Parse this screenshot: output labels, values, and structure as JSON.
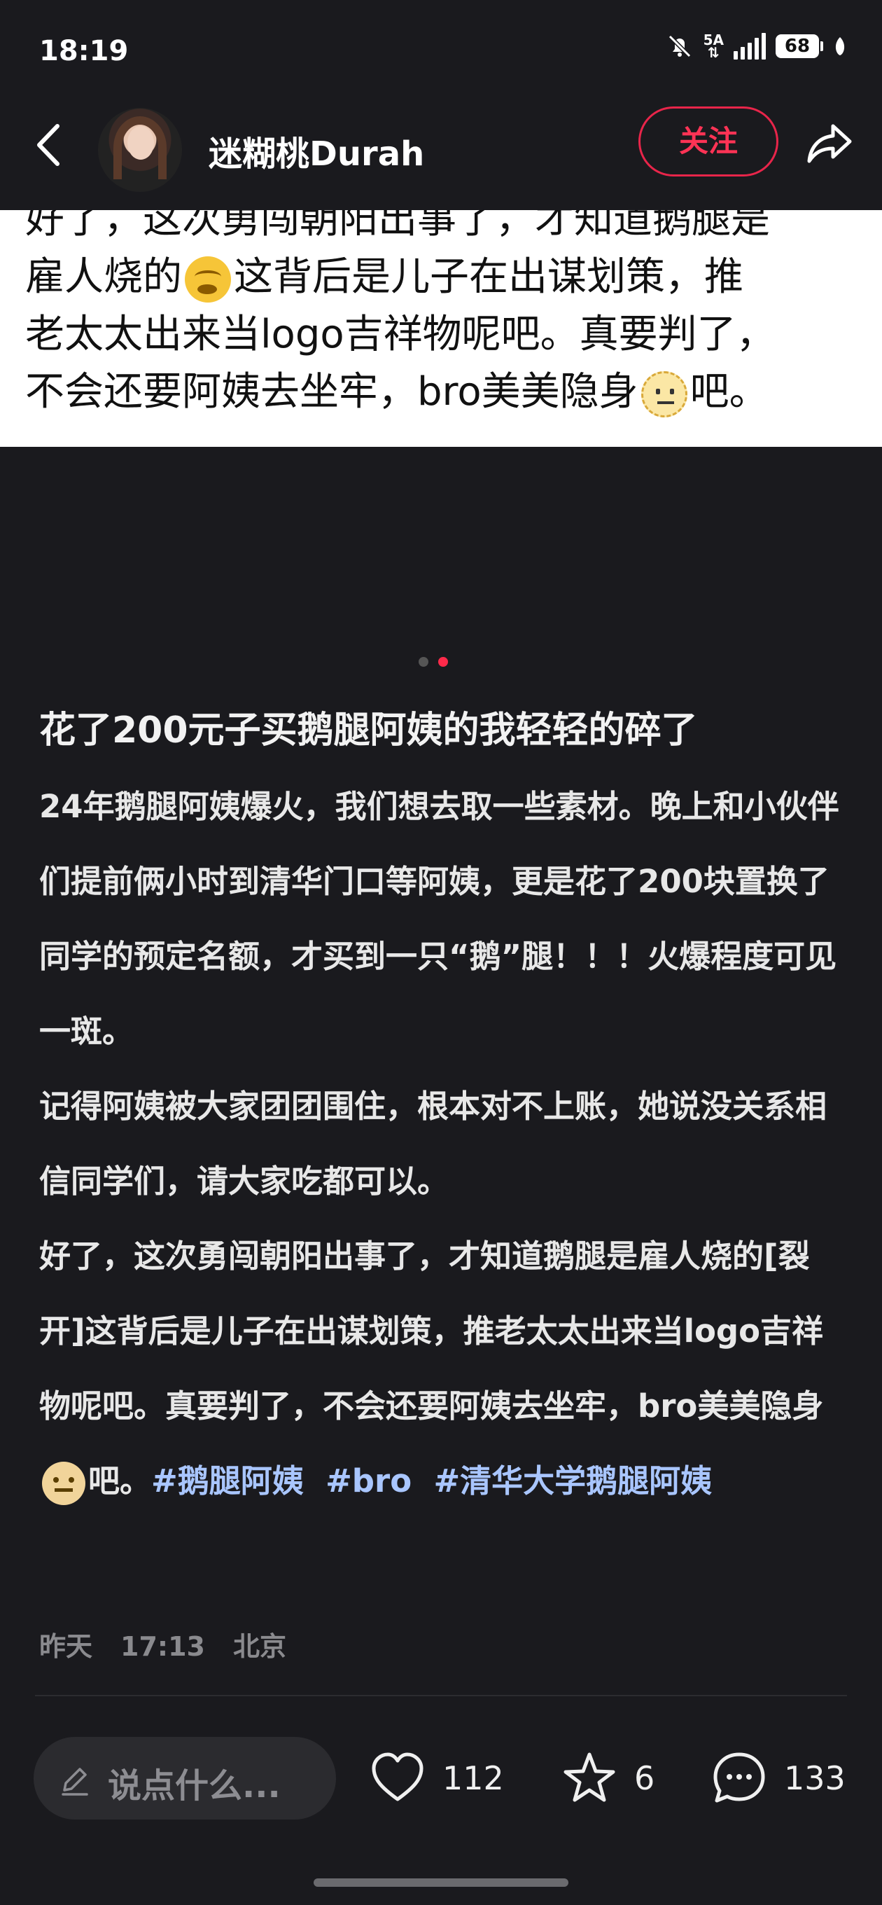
{
  "status": {
    "time": "18:19",
    "network": "5A",
    "battery": "68"
  },
  "header": {
    "username": "迷糊桃Durah",
    "follow_label": "关注"
  },
  "image": {
    "line0": "好了，这次勇闯朝阳出事了，才知道鹅腿是",
    "line1a": "雇人烧的",
    "line1b": "这背后是儿子在出谋划策，推",
    "line2": "老太太出来当logo吉祥物呢吧。真要判了，",
    "line3a": "不会还要阿姨去坐牢，bro美美隐身",
    "line3b": "吧。"
  },
  "post": {
    "title": "花了200元子买鹅腿阿姨的我轻轻的碎了",
    "paragraph1": "24年鹅腿阿姨爆火，我们想去取一些素材。晚上和小伙伴们提前俩小时到清华门口等阿姨，更是花了200块置换了同学的预定名额，才买到一只“鹅”腿！！！火爆程度可见一斑。",
    "paragraph2": "记得阿姨被大家团团围住，根本对不上账，她说没关系相信同学们，请大家吃都可以。",
    "paragraph3": "好了，这次勇闯朝阳出事了，才知道鹅腿是雇人烧的[裂开]这背后是儿子在出谋划策，推老太太出来当logo吉祥物呢吧。真要判了，不会还要阿姨去坐牢，bro美美隐身",
    "paragraph3_end": "吧。",
    "tags": [
      "#鹅腿阿姨",
      "#bro",
      "#清华大学鹅腿阿姨"
    ]
  },
  "meta": {
    "date": "昨天",
    "time": "17:13",
    "location": "北京"
  },
  "bottom_bar": {
    "comment_placeholder": "说点什么...",
    "likes": "112",
    "stars": "6",
    "comments": "133"
  },
  "colors": {
    "accent": "#ff2a4a",
    "tag": "#a9c6ff",
    "background": "#1a1a1e"
  }
}
